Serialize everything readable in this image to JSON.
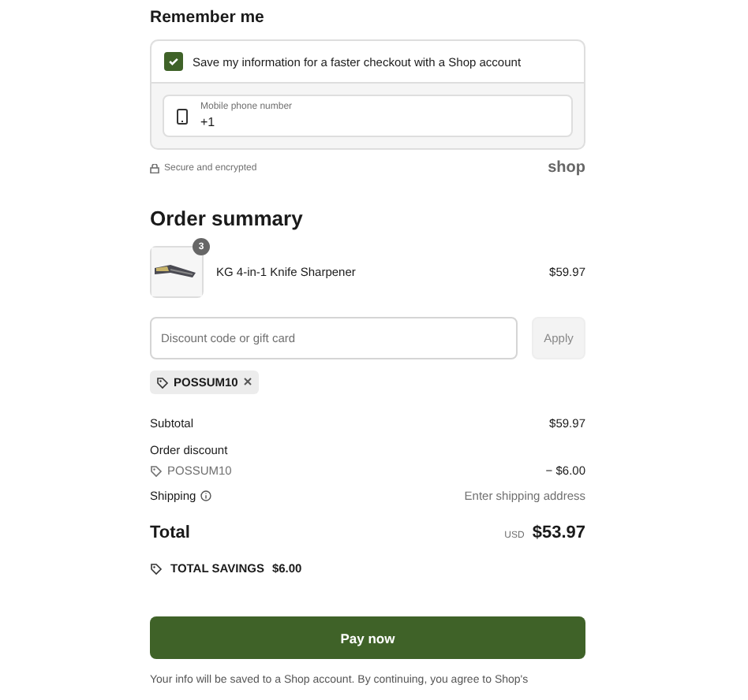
{
  "remember": {
    "title": "Remember me",
    "checkbox": {
      "label": "Save my information for a faster checkout with a Shop account",
      "checked": true
    },
    "phone": {
      "label": "Mobile phone number",
      "value": "+1"
    },
    "secure": "Secure and encrypted",
    "brand": "shop"
  },
  "summary": {
    "title": "Order summary",
    "items": [
      {
        "name": "KG 4-in-1 Knife Sharpener",
        "quantity": "3",
        "price": "$59.97"
      }
    ],
    "discount": {
      "placeholder": "Discount code or gift card",
      "button": "Apply",
      "tags": [
        "POSSUM10"
      ]
    },
    "lines": [
      {
        "kind": "plain",
        "label": "Subtotal",
        "value": "$59.97"
      },
      {
        "kind": "discount",
        "label": "Order discount",
        "code": "POSSUM10",
        "value": "− $6.00"
      },
      {
        "kind": "info",
        "label": "Shipping",
        "value": "Enter shipping address"
      }
    ],
    "total": {
      "label": "Total",
      "currency": "USD",
      "value": "$53.97"
    },
    "savings": {
      "label": "TOTAL SAVINGS",
      "value": "$6.00"
    }
  },
  "pay": {
    "button": "Pay now",
    "note": "Your info will be saved to a Shop account. By continuing, you agree to Shop's"
  }
}
